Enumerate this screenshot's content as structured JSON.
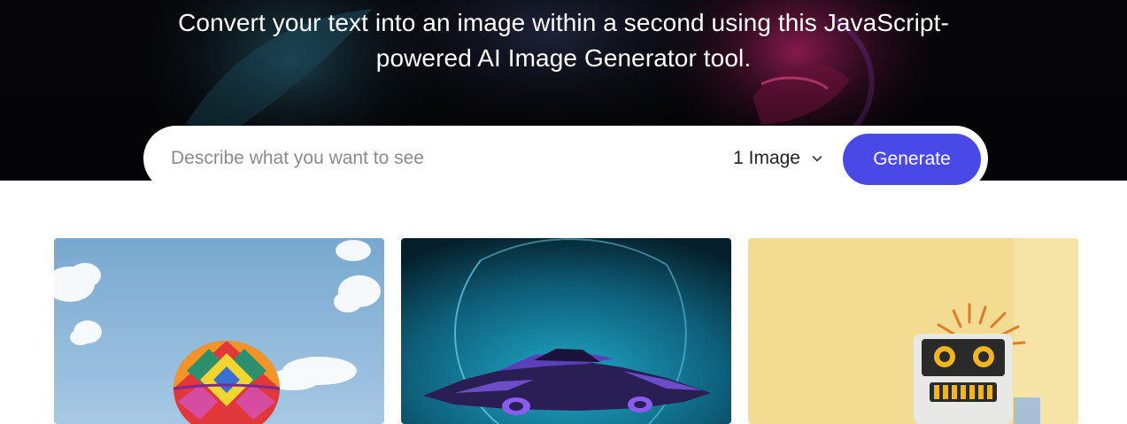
{
  "hero": {
    "subtitle": "Convert your text into an image within a second using this JavaScript-powered AI Image Generator tool."
  },
  "prompt_form": {
    "placeholder": "Describe what you want to see",
    "image_count_selected": "1 Image",
    "generate_label": "Generate"
  },
  "colors": {
    "accent": "#4949e7",
    "hero_background": "#07070a"
  },
  "icons": {
    "select_chevron": "chevron-down-icon"
  },
  "gallery": {
    "images": [
      {
        "subject": "hot-air-balloon"
      },
      {
        "subject": "futuristic-car"
      },
      {
        "subject": "toy-robot"
      }
    ]
  }
}
